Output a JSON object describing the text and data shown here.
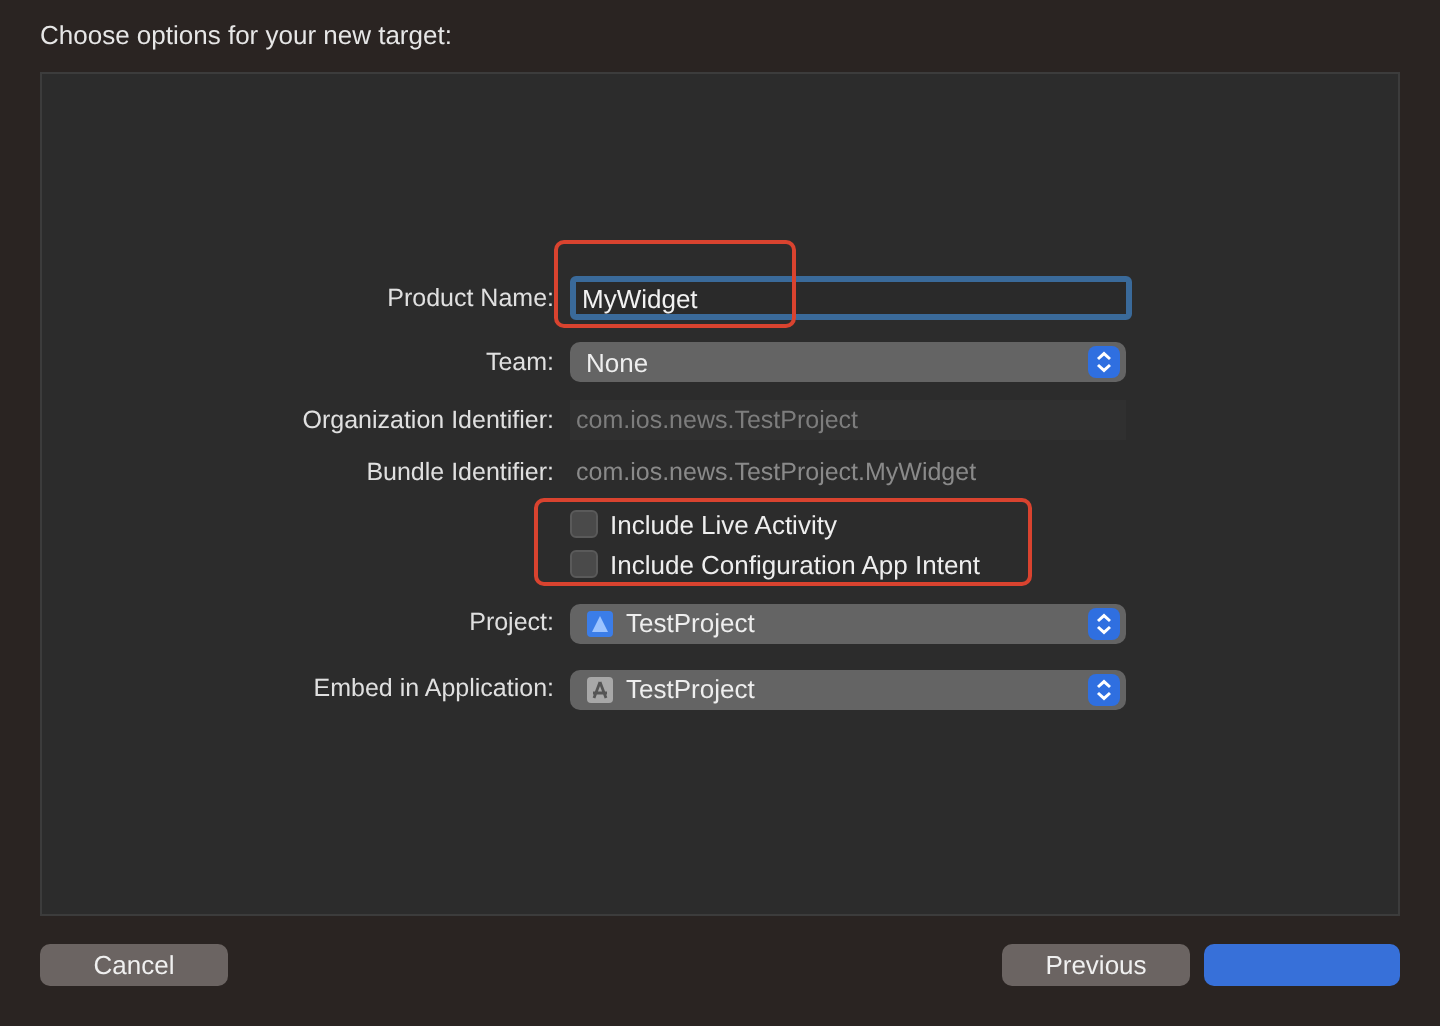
{
  "window": {
    "title": "Choose options for your new target:"
  },
  "form": {
    "rows": [
      {
        "kind": "text",
        "label": "Product Name:",
        "value": "MyWidget",
        "focused": true,
        "highlighted": true
      },
      {
        "kind": "popup",
        "label": "Team:",
        "value": "None"
      },
      {
        "kind": "field",
        "label": "Organization Identifier:",
        "placeholder": "com.ios.news.TestProject"
      },
      {
        "kind": "static",
        "label": "Bundle Identifier:",
        "value": "com.ios.news.TestProject.MyWidget"
      },
      {
        "kind": "checks",
        "highlighted": true,
        "items": [
          {
            "label": "Include Live Activity",
            "checked": false
          },
          {
            "label": "Include Configuration App Intent",
            "checked": false
          }
        ]
      },
      {
        "kind": "project_popup",
        "label": "Project:",
        "value": "TestProject"
      },
      {
        "kind": "app_popup",
        "label": "Embed in Application:",
        "value": "TestProject"
      }
    ]
  },
  "buttons": [
    {
      "kind": "default",
      "label": "Cancel"
    },
    {
      "kind": "default",
      "label": "Previous"
    },
    {
      "kind": "primary"
    }
  ]
}
